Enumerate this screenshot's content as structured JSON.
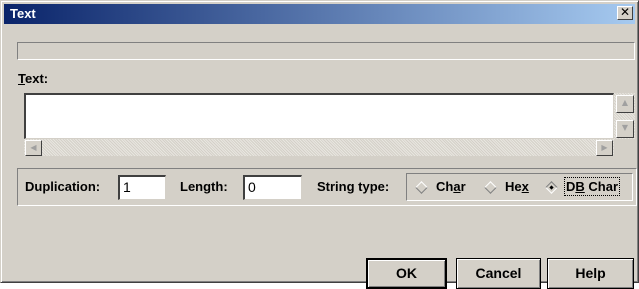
{
  "window": {
    "title": "Text",
    "close_glyph": "✕"
  },
  "text_section": {
    "label_mnemonic": "T",
    "label_rest": "ext:",
    "value": ""
  },
  "scrollbar": {
    "up_arrow": "▲",
    "down_arrow": "▼",
    "left_arrow": "◀",
    "right_arrow": "▶"
  },
  "options": {
    "duplication_label": "Duplication:",
    "duplication_value": "1",
    "length_label": "Length:",
    "length_value": "0",
    "string_type_label": "String type:",
    "string_types": [
      {
        "pre": "Ch",
        "mnemonic": "a",
        "post": "r",
        "selected": false
      },
      {
        "pre": "He",
        "mnemonic": "x",
        "post": "",
        "selected": false
      },
      {
        "pre": "D",
        "mnemonic": "B",
        "post": " Char",
        "selected": true
      }
    ]
  },
  "buttons": {
    "ok": "OK",
    "cancel": "Cancel",
    "help": "Help"
  },
  "colors": {
    "face": "#d4d0c8",
    "title_start": "#0a246a",
    "title_end": "#a6caf0"
  }
}
